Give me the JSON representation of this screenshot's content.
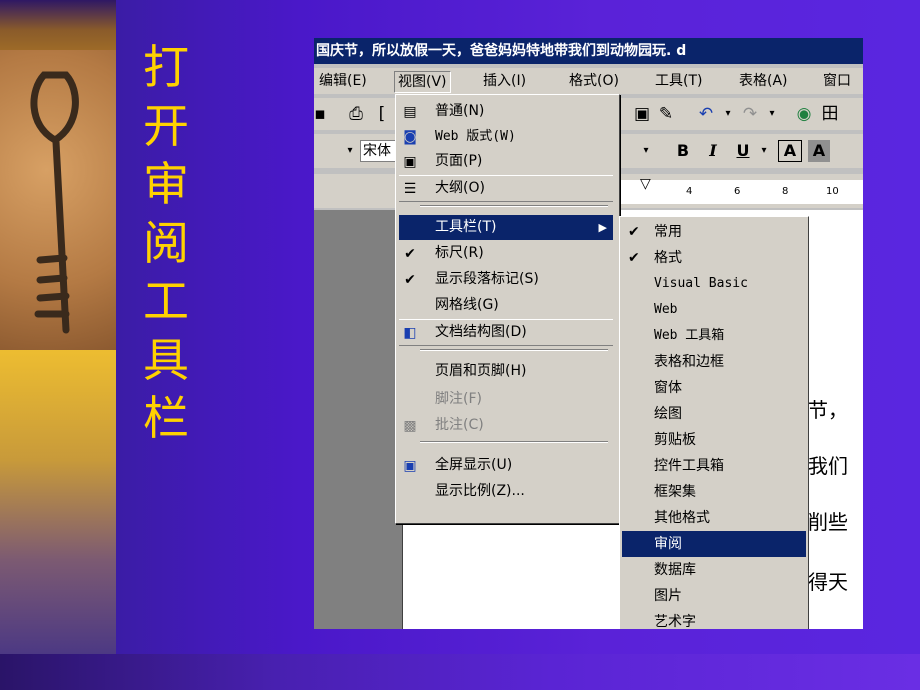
{
  "slide": {
    "title_chars": [
      "打",
      "开",
      "审",
      "阅",
      "工",
      "具",
      "栏"
    ],
    "title_color": "#ffd200",
    "background_color": "#5a26e0"
  },
  "word": {
    "title_text": "国庆节，所以放假一天，爸爸妈妈特地带我们到动物园玩. d",
    "menubar": [
      "编辑(E)",
      "视图(V)",
      "插入(I)",
      "格式(O)",
      "工具(T)",
      "表格(A)",
      "窗口"
    ],
    "font_name": "宋体",
    "format_buttons": [
      "B",
      "I",
      "U",
      "A",
      "A"
    ],
    "ruler_ticks": [
      "4",
      "6",
      "8",
      "10"
    ],
    "doc_fragments": [
      "节，",
      "我们",
      "削些",
      "得天"
    ]
  },
  "view_menu": {
    "items": [
      {
        "label": "普通(N)",
        "icon": "normal-view-icon"
      },
      {
        "label": "Web 版式(W)",
        "icon": "web-layout-icon"
      },
      {
        "label": "页面(P)",
        "icon": "page-view-icon"
      },
      {
        "label": "大纲(O)",
        "icon": "outline-icon"
      },
      {
        "label": "工具栏(T)",
        "selected": true
      },
      {
        "label": "标尺(R)",
        "checked": true
      },
      {
        "label": "显示段落标记(S)",
        "checked": true
      },
      {
        "label": "网格线(G)"
      },
      {
        "label": "文档结构图(D)",
        "icon": "document-map-icon"
      },
      {
        "label": "页眉和页脚(H)"
      },
      {
        "label": "脚注(F)",
        "disabled": true
      },
      {
        "label": "批注(C)",
        "disabled": true,
        "icon": "comment-icon"
      },
      {
        "label": "全屏显示(U)",
        "icon": "fullscreen-icon"
      },
      {
        "label": "显示比例(Z)..."
      }
    ]
  },
  "toolbars_submenu": {
    "items": [
      {
        "label": "常用",
        "checked": true
      },
      {
        "label": "格式",
        "checked": true
      },
      {
        "label": "Visual Basic"
      },
      {
        "label": "Web"
      },
      {
        "label": "Web 工具箱"
      },
      {
        "label": "表格和边框"
      },
      {
        "label": "窗体"
      },
      {
        "label": "绘图"
      },
      {
        "label": "剪贴板"
      },
      {
        "label": "控件工具箱"
      },
      {
        "label": "框架集"
      },
      {
        "label": "其他格式"
      },
      {
        "label": "审阅",
        "selected": true
      },
      {
        "label": "数据库"
      },
      {
        "label": "图片"
      },
      {
        "label": "艺术字"
      }
    ]
  }
}
